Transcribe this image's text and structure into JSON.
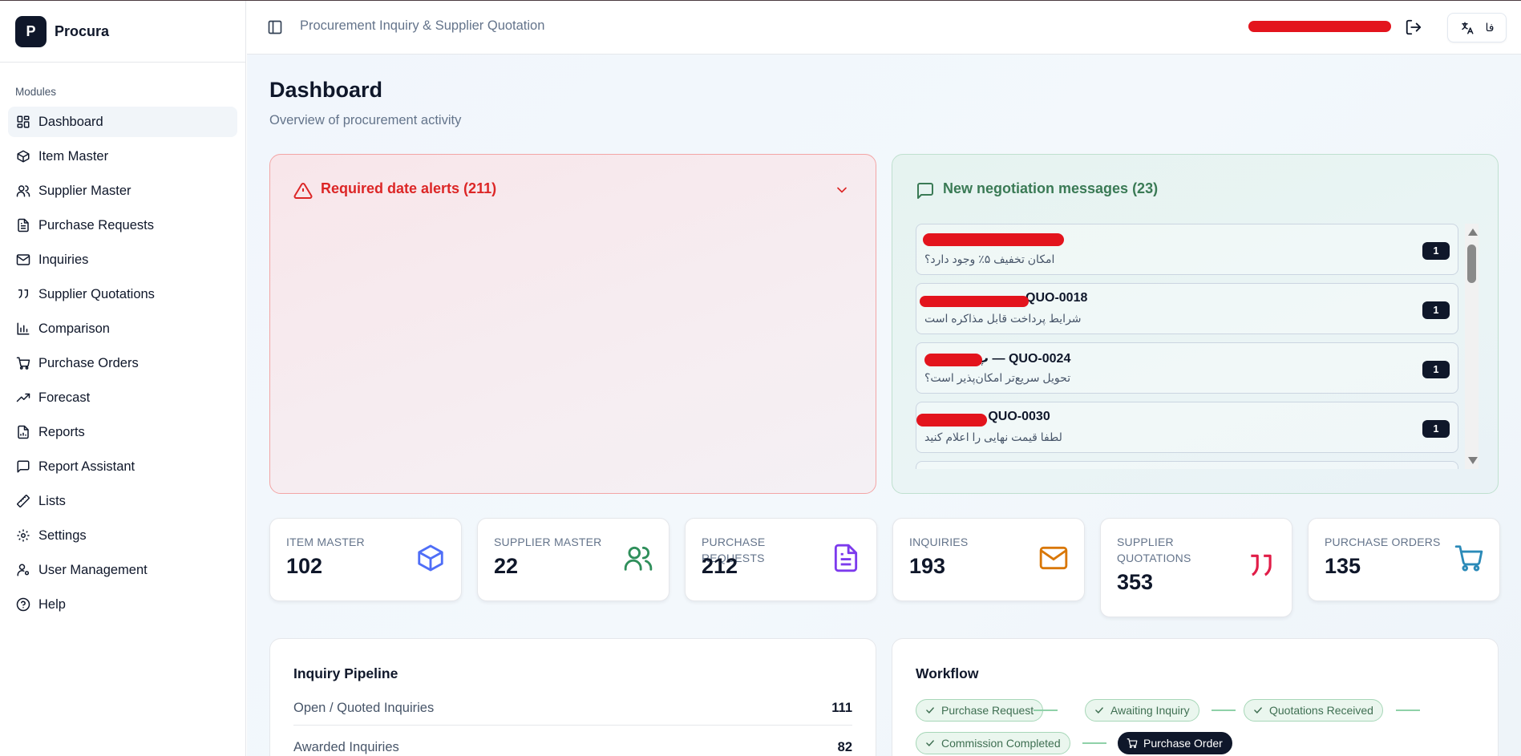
{
  "app": {
    "logo_letter": "P",
    "name": "Procura"
  },
  "sidebar": {
    "section": "Modules",
    "items": [
      {
        "label": "Dashboard",
        "icon": "dashboard-icon",
        "active": true
      },
      {
        "label": "Item Master",
        "icon": "box-icon"
      },
      {
        "label": "Supplier Master",
        "icon": "users-icon"
      },
      {
        "label": "Purchase Requests",
        "icon": "file-text-icon"
      },
      {
        "label": "Inquiries",
        "icon": "mail-icon"
      },
      {
        "label": "Supplier Quotations",
        "icon": "quote-icon"
      },
      {
        "label": "Comparison",
        "icon": "bar-chart-icon"
      },
      {
        "label": "Purchase Orders",
        "icon": "cart-icon"
      },
      {
        "label": "Forecast",
        "icon": "trending-up-icon"
      },
      {
        "label": "Reports",
        "icon": "report-icon"
      },
      {
        "label": "Report Assistant",
        "icon": "chat-icon"
      },
      {
        "label": "Lists",
        "icon": "ruler-icon"
      },
      {
        "label": "Settings",
        "icon": "gear-icon"
      },
      {
        "label": "User Management",
        "icon": "user-cog-icon"
      },
      {
        "label": "Help",
        "icon": "help-icon"
      }
    ]
  },
  "header": {
    "title": "Procurement Inquiry & Supplier Quotation",
    "lang_label": "فا"
  },
  "page": {
    "title": "Dashboard",
    "subtitle": "Overview of procurement activity"
  },
  "alerts": {
    "title": "Required date alerts (211)"
  },
  "negotiation": {
    "title": "New negotiation messages (23)",
    "messages": [
      {
        "title": "",
        "subtitle": "امکان تخفیف ۵٪ وجود دارد؟",
        "count": "1"
      },
      {
        "title": "QUO-0018",
        "subtitle": "شرایط پرداخت قابل مذاکره است",
        "count": "1"
      },
      {
        "title": "پ — QUO-0024",
        "subtitle": "تحویل سریع‌تر امکان‌پذیر است؟",
        "count": "1"
      },
      {
        "title": "– QUO-0030",
        "subtitle": "لطفا قیمت نهایی را اعلام کنید",
        "count": "1"
      }
    ]
  },
  "stats": [
    {
      "label": "ITEM MASTER",
      "value": "102",
      "icon": "box-icon",
      "color": "#4f6ef7"
    },
    {
      "label": "SUPPLIER MASTER",
      "value": "22",
      "icon": "users-icon",
      "color": "#2f8f5b"
    },
    {
      "label": "PURCHASE REQUESTS",
      "value": "212",
      "icon": "file-text-icon",
      "color": "#7c3aed"
    },
    {
      "label": "INQUIRIES",
      "value": "193",
      "icon": "mail-icon",
      "color": "#d97706"
    },
    {
      "label": "SUPPLIER QUOTATIONS",
      "value": "353",
      "icon": "quote-icon",
      "color": "#e11d48"
    },
    {
      "label": "PURCHASE ORDERS",
      "value": "135",
      "icon": "cart-icon",
      "color": "#2b8ab8"
    }
  ],
  "pipeline": {
    "title": "Inquiry Pipeline",
    "rows": [
      {
        "label": "Open / Quoted Inquiries",
        "value": "111"
      },
      {
        "label": "Awarded Inquiries",
        "value": "82"
      }
    ]
  },
  "workflow": {
    "title": "Workflow",
    "steps": [
      {
        "label": "Purchase Request",
        "done": true
      },
      {
        "label": "Awaiting Inquiry",
        "done": true
      },
      {
        "label": "Quotations Received",
        "done": true
      },
      {
        "label": "Commission Completed",
        "done": true
      },
      {
        "label": "Purchase Order",
        "current": true
      }
    ]
  }
}
